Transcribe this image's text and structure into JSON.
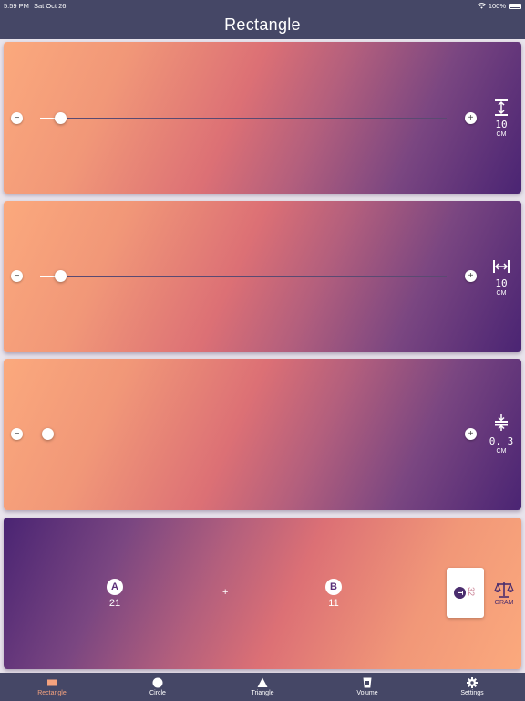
{
  "status_bar": {
    "time": "5:59 PM",
    "date": "Sat Oct 26",
    "battery": "100%"
  },
  "header": {
    "title": "Rectangle"
  },
  "sliders": [
    {
      "id": "length",
      "value": "10",
      "unit": "CM",
      "icon": "height-arrow-icon",
      "fraction": 0.05
    },
    {
      "id": "width",
      "value": "10",
      "unit": "CM",
      "icon": "width-arrow-icon",
      "fraction": 0.05
    },
    {
      "id": "thickness",
      "value": "0. 3",
      "unit": "CM",
      "icon": "thickness-arrow-icon",
      "fraction": 0.02
    }
  ],
  "calc": {
    "a_label": "A",
    "a_value": "21",
    "plus": "+",
    "b_label": "B",
    "b_value": "11",
    "total_label": "T",
    "total_value": "32",
    "unit": "GRAM",
    "unit_icon": "scale-icon"
  },
  "tabs": [
    {
      "label": "Rectangle",
      "icon": "rectangle-icon",
      "active": true
    },
    {
      "label": "Circle",
      "icon": "circle-icon",
      "active": false
    },
    {
      "label": "Triangle",
      "icon": "triangle-icon",
      "active": false
    },
    {
      "label": "Volume",
      "icon": "cup-icon",
      "active": false
    },
    {
      "label": "Settings",
      "icon": "gear-icon",
      "active": false
    }
  ],
  "colors": {
    "bar": "#454766",
    "accent": "#f5a27e",
    "gradient_light": "#fba97d",
    "gradient_mid": "#dc7075",
    "gradient_dark": "#4a2473"
  }
}
